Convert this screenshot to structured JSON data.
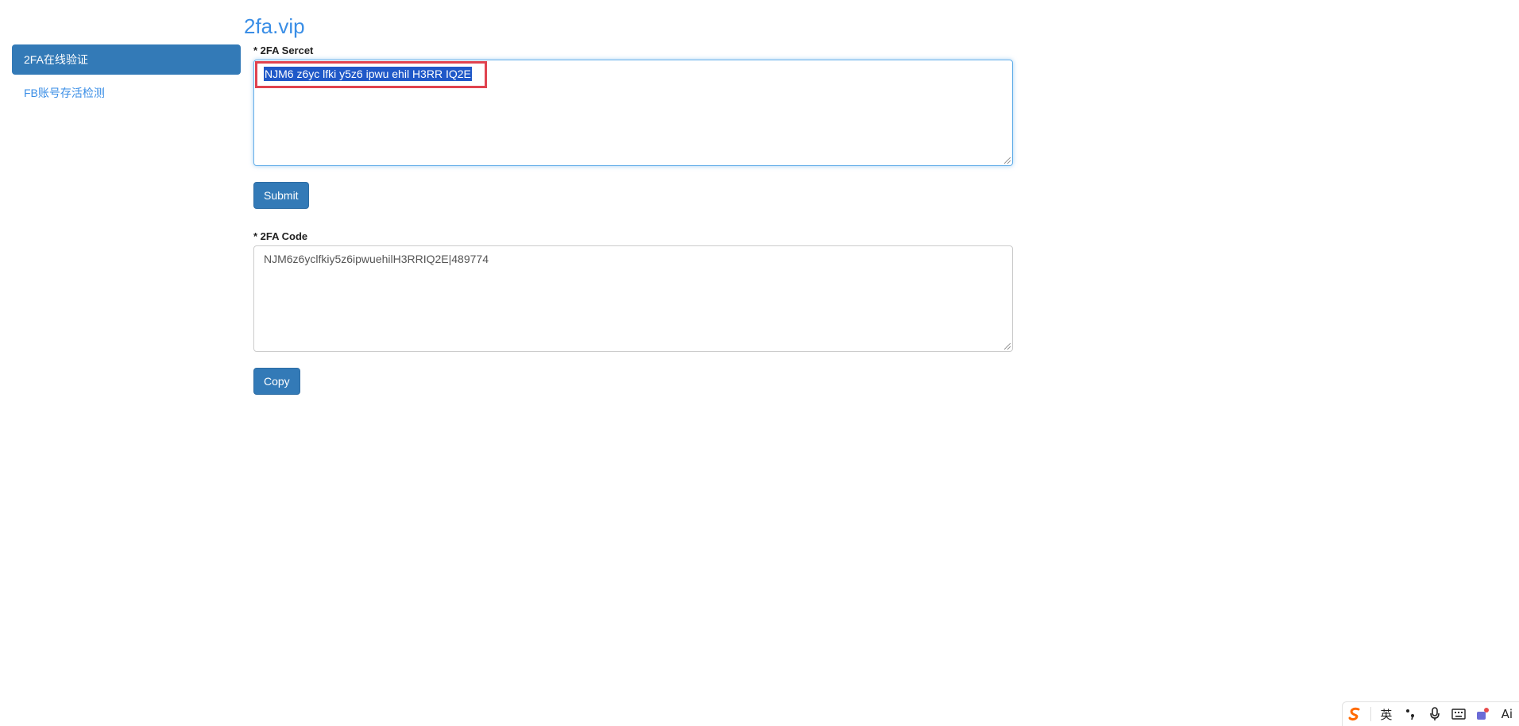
{
  "site": {
    "title": "2fa.vip"
  },
  "sidebar": {
    "items": [
      {
        "label": "2FA在线验证",
        "active": true
      },
      {
        "label": "FB账号存活检测",
        "active": false
      }
    ]
  },
  "form": {
    "secret_label": "* 2FA Sercet",
    "secret_value": "NJM6 z6yc lfki y5z6 ipwu ehil H3RR IQ2E",
    "submit_label": "Submit",
    "code_label": "* 2FA Code",
    "code_value": "NJM6z6yclfkiy5z6ipwuehilH3RRIQ2E|489774",
    "copy_label": "Copy"
  },
  "ime_toolbar": {
    "language": "英",
    "icons": [
      "sogou-logo-icon",
      "punctuation-icon",
      "microphone-icon",
      "keyboard-icon",
      "skin-icon",
      "ai-icon"
    ],
    "ai_label": "Ai"
  },
  "colors": {
    "primary": "#337ab7",
    "link": "#3a8ee6",
    "highlight": "#e0434f",
    "selection": "#1f58c8"
  }
}
